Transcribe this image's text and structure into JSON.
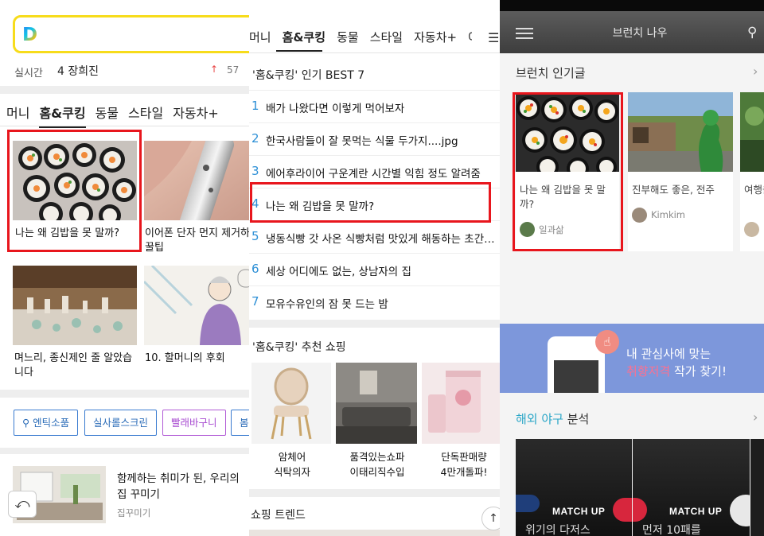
{
  "panel1": {
    "realtime": {
      "label": "실시간",
      "rank": "4 장희진",
      "arrow": "↑",
      "count": "57"
    },
    "tabs": [
      "머니",
      "홈&쿠킹",
      "동물",
      "스타일",
      "자동차+"
    ],
    "active_tab": "홈&쿠킹",
    "articles": [
      {
        "caption": "나는 왜 김밥을 못 말까?"
      },
      {
        "caption": "이어폰 단자 먼지 제거하는 꿀팁"
      },
      {
        "caption": "며느리, 종신제인 줄 알았습니다"
      },
      {
        "caption": "10. 할머니의 후회"
      }
    ],
    "tags": [
      "엔틱소품",
      "실사롤스크린",
      "빨래바구니",
      "봄"
    ],
    "card": {
      "title": "함께하는 취미가 된, 우리의 집 꾸미기",
      "source": "집꾸미기"
    },
    "back_icon": "⤺"
  },
  "panel2": {
    "tabs": [
      "머니",
      "홈&쿠킹",
      "동물",
      "스타일",
      "자동차+",
      "여행"
    ],
    "active_tab": "홈&쿠킹",
    "menu_icon": "☰",
    "best_title": "'홈&쿠킹' 인기 BEST 7",
    "ranking": [
      {
        "num": "1",
        "text": "배가 나왔다면 이렇게 먹어보자"
      },
      {
        "num": "2",
        "text": "한국사람들이 잘 못먹는 식물 두가지....jpg"
      },
      {
        "num": "3",
        "text": "에어후라이어 구운계란 시간별 익힘 정도 알려줌"
      },
      {
        "num": "4",
        "text": "나는 왜 김밥을 못 말까?"
      },
      {
        "num": "5",
        "text": "냉동식빵 갓 사온 식빵처럼 맛있게 해동하는 초간단..."
      },
      {
        "num": "6",
        "text": "세상 어디에도 없는, 상남자의 집"
      },
      {
        "num": "7",
        "text": "모유수유인의 잠 못 드는 밤"
      }
    ],
    "shop_title": "'홈&쿠킹' 추천 쇼핑",
    "shop_items": [
      {
        "line1": "암체어",
        "line2": "식탁의자"
      },
      {
        "line1": "품격있는쇼파",
        "line2": "이태리직수입"
      },
      {
        "line1": "단독판매량",
        "line2": "4만개돌파!"
      }
    ],
    "trend_title": "쇼핑 트렌드",
    "up_icon": "↑"
  },
  "panel3": {
    "title": "브런치 나우",
    "search_icon": "⚲",
    "popular_title": "브런치 인기글",
    "chevron": "›",
    "cards": [
      {
        "caption": "나는 왜 김밥을 못 말까?",
        "author": "일과삶"
      },
      {
        "caption": "진부해도 좋은, 전주",
        "author": "Kimkim"
      },
      {
        "caption": "여행을 괜찮을",
        "author": ""
      }
    ],
    "banner": {
      "line1": "내 관심사에 맞는",
      "highlight": "취향저격",
      "line2_rest": " 작가 찾기!"
    },
    "baseball_title_accent": "해외 야구",
    "baseball_title_rest": " 분석",
    "baseball": [
      {
        "label": "MATCH UP",
        "text": "위기의 다저스"
      },
      {
        "label": "MATCH UP",
        "text": "먼저 10패를"
      }
    ]
  }
}
